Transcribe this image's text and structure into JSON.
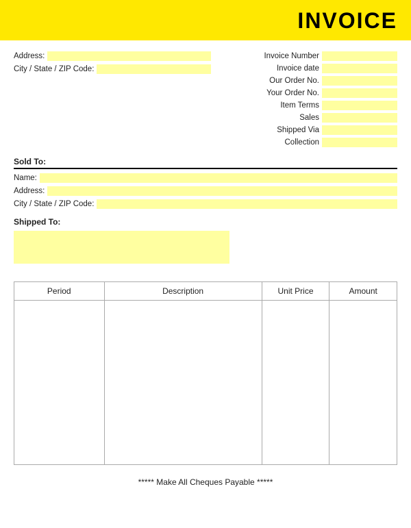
{
  "header": {
    "title": "INVOICE"
  },
  "left_top": {
    "address_label": "Address:",
    "city_label": "City / State / ZIP Code:"
  },
  "right_top": {
    "fields": [
      {
        "label": "Invoice Number",
        "id": "invoice-number"
      },
      {
        "label": "Invoice date",
        "id": "invoice-date"
      },
      {
        "label": "Our Order No.",
        "id": "our-order-no"
      },
      {
        "label": "Your Order No.",
        "id": "your-order-no"
      },
      {
        "label": "Item Terms",
        "id": "item-terms"
      },
      {
        "label": "Sales",
        "id": "sales"
      },
      {
        "label": "Shipped Via",
        "id": "shipped-via"
      },
      {
        "label": "Collection",
        "id": "collection"
      }
    ]
  },
  "sold_to": {
    "label": "Sold To:",
    "name_label": "Name:",
    "address_label": "Address:",
    "city_label": "City / State / ZIP Code:"
  },
  "shipped_to": {
    "label": "Shipped To:"
  },
  "table": {
    "columns": [
      {
        "label": "Period"
      },
      {
        "label": "Description"
      },
      {
        "label": "Unit Price"
      },
      {
        "label": "Amount"
      }
    ]
  },
  "footer": {
    "text": "***** Make All Cheques Payable *****"
  }
}
